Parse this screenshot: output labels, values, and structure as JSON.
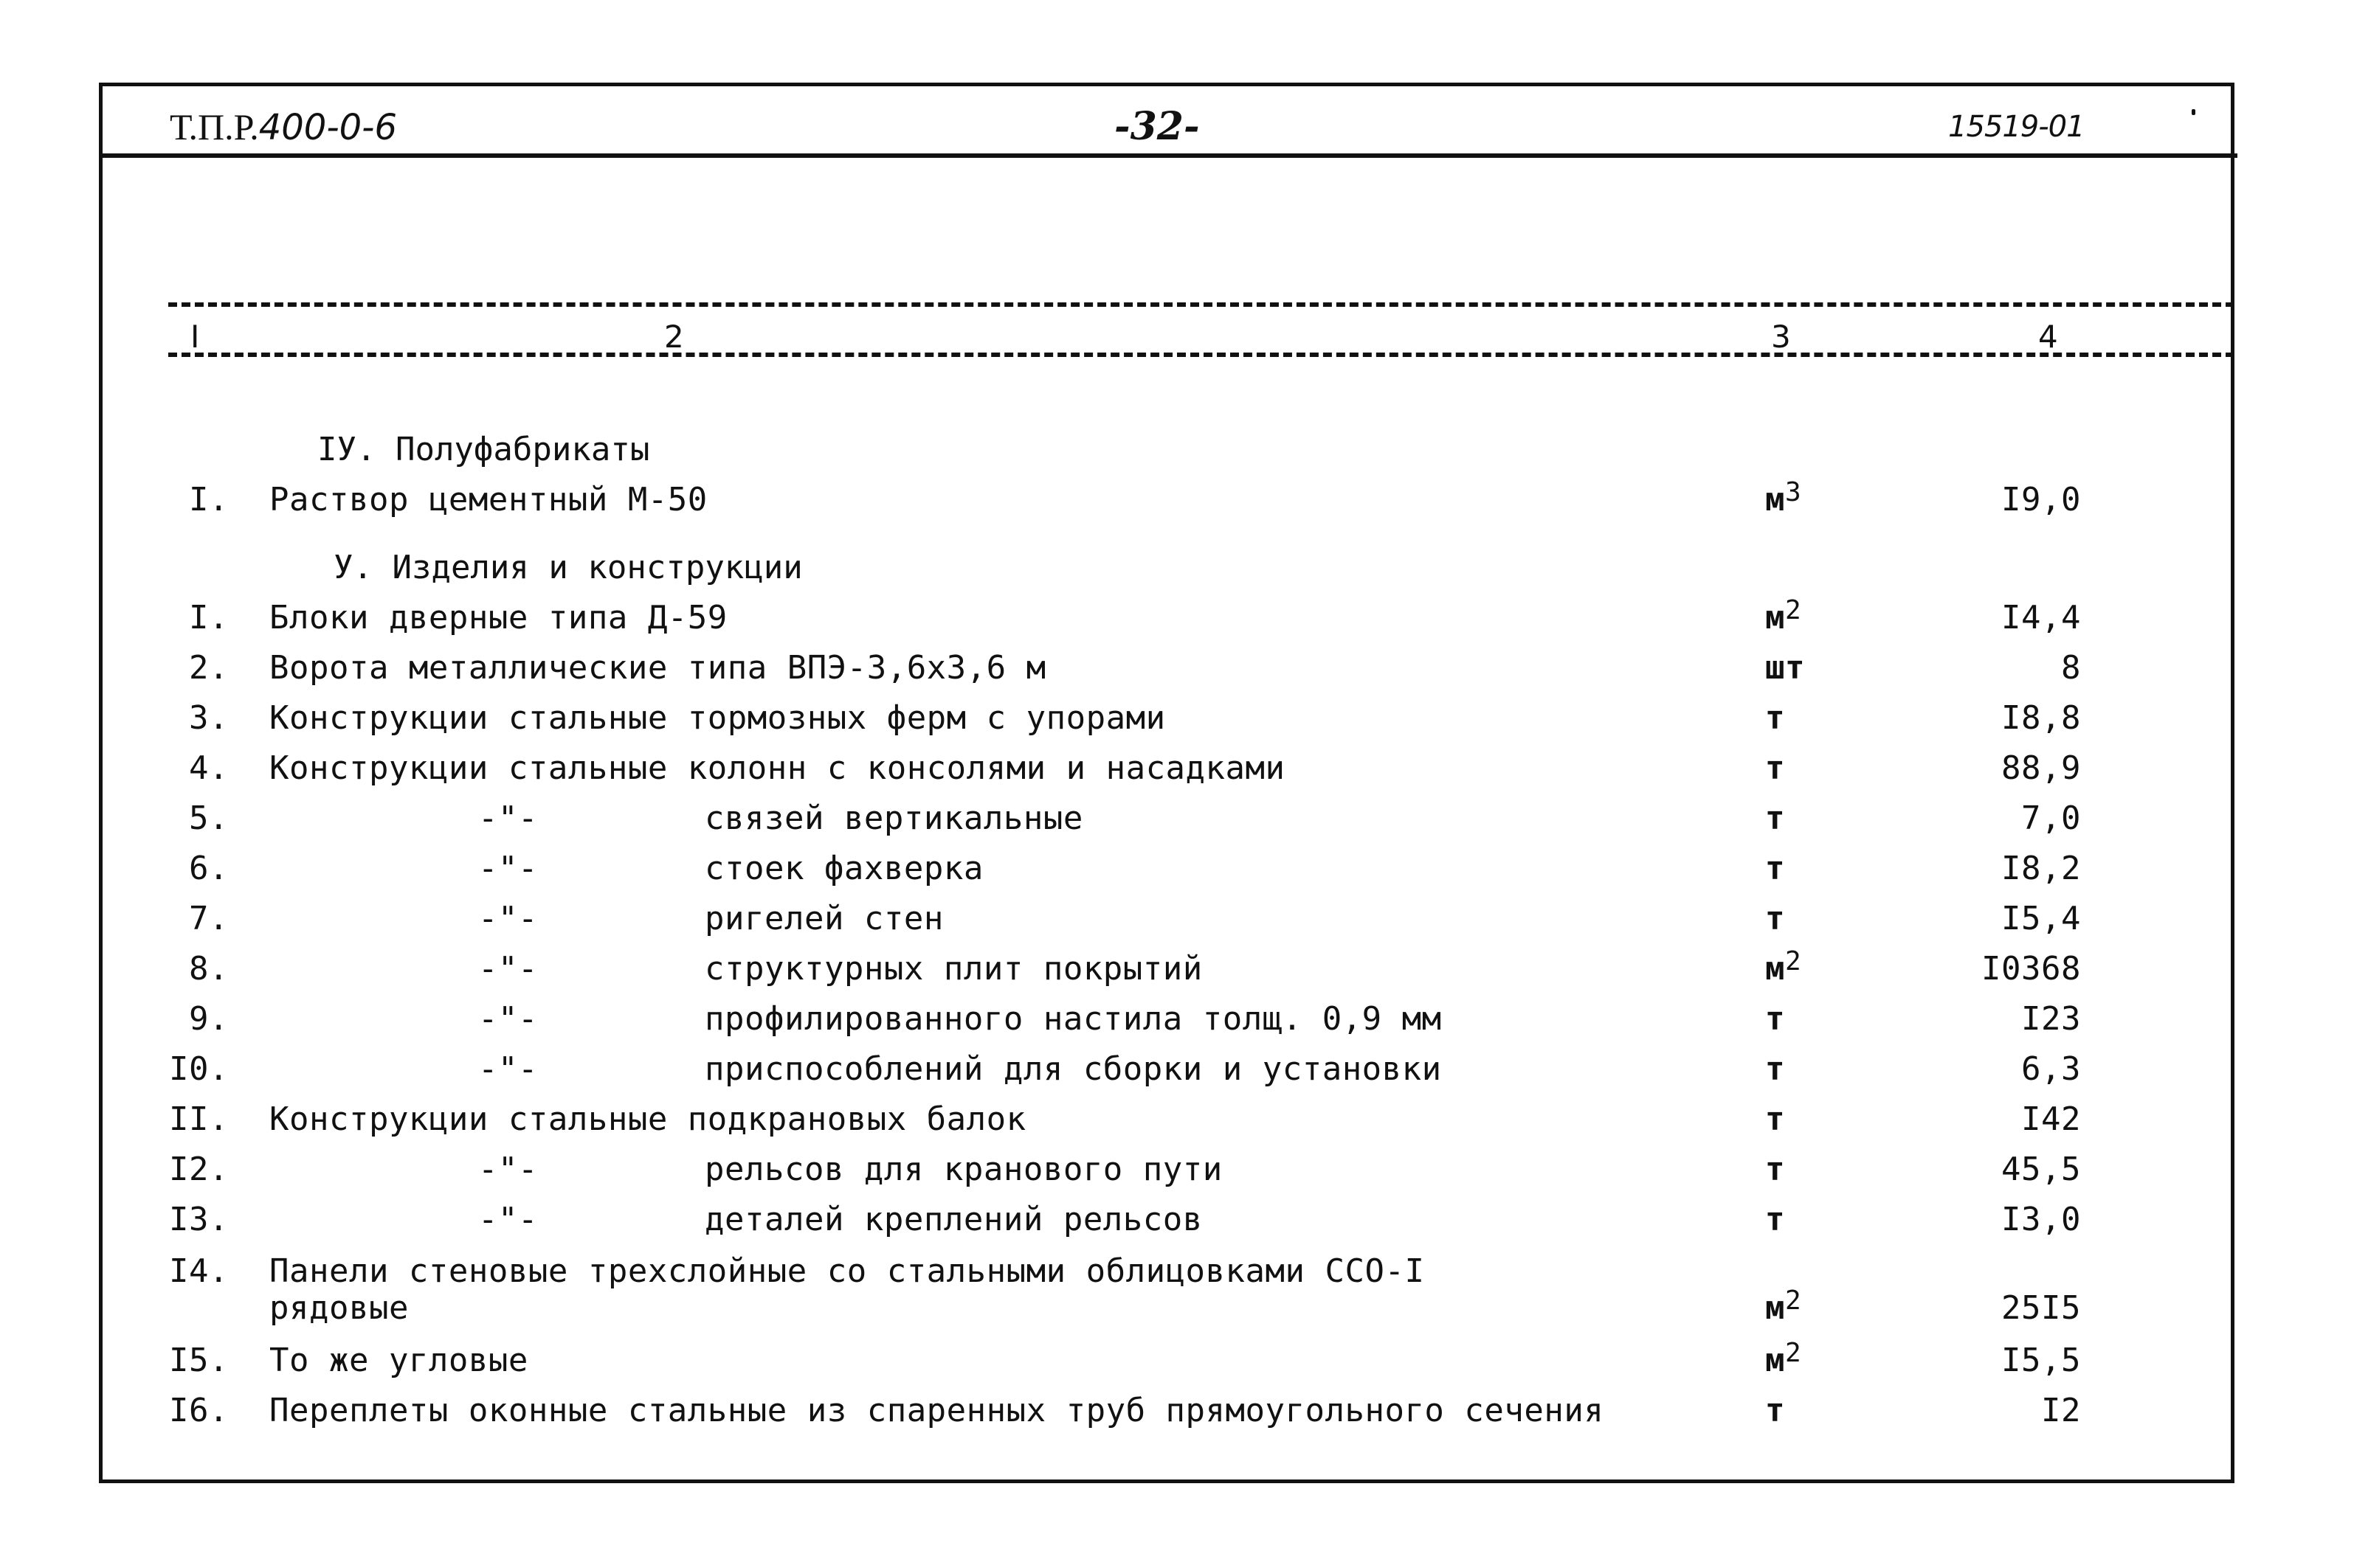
{
  "header": {
    "doc_code_prefix": "Т.П.Р.",
    "doc_code_number": "400-0-6",
    "page_number": "-32-",
    "sheet_code": "15519-01"
  },
  "columns": [
    "I",
    "2",
    "3",
    "4"
  ],
  "sections": [
    {
      "title": "IУ. Полуфабрикаты",
      "rows": [
        {
          "num": "I.",
          "text": "Раствор цементный М-50",
          "ditto": "",
          "text2": "",
          "unit": "м",
          "unit_sup": "3",
          "qty": "I9,0"
        }
      ]
    },
    {
      "title": "У. Изделия и конструкции",
      "rows": [
        {
          "num": "I.",
          "text": "Блоки дверные типа Д-59",
          "ditto": "",
          "text2": "",
          "unit": "м",
          "unit_sup": "2",
          "qty": "I4,4"
        },
        {
          "num": "2.",
          "text": "Ворота металлические типа ВПЭ-3,6х3,6 м",
          "ditto": "",
          "text2": "",
          "unit": "шт",
          "unit_sup": "",
          "qty": "8"
        },
        {
          "num": "3.",
          "text": "Конструкции стальные тормозных ферм с упорами",
          "ditto": "",
          "text2": "",
          "unit": "т",
          "unit_sup": "",
          "qty": "I8,8"
        },
        {
          "num": "4.",
          "text": "Конструкции стальные колонн с консолями и насадками",
          "ditto": "",
          "text2": "",
          "unit": "т",
          "unit_sup": "",
          "qty": "88,9"
        },
        {
          "num": "5.",
          "text": "",
          "ditto": "-\"-",
          "text2": "связей вертикальные",
          "unit": "т",
          "unit_sup": "",
          "qty": "7,0"
        },
        {
          "num": "6.",
          "text": "",
          "ditto": "-\"-",
          "text2": "стоек фахверка",
          "unit": "т",
          "unit_sup": "",
          "qty": "I8,2"
        },
        {
          "num": "7.",
          "text": "",
          "ditto": "-\"-",
          "text2": "ригелей стен",
          "unit": "т",
          "unit_sup": "",
          "qty": "I5,4"
        },
        {
          "num": "8.",
          "text": "",
          "ditto": "-\"-",
          "text2": "структурных плит покрытий",
          "unit": "м",
          "unit_sup": "2",
          "qty": "I0368"
        },
        {
          "num": "9.",
          "text": "",
          "ditto": "-\"-",
          "text2": "профилированного настила толщ. 0,9 мм",
          "unit": "т",
          "unit_sup": "",
          "qty": "I23"
        },
        {
          "num": "I0.",
          "text": "",
          "ditto": "-\"-",
          "text2": "приспособлений для сборки и установки",
          "unit": "т",
          "unit_sup": "",
          "qty": "6,3"
        },
        {
          "num": "II.",
          "text": "Конструкции стальные подкрановых балок",
          "ditto": "",
          "text2": "",
          "unit": "т",
          "unit_sup": "",
          "qty": "I42"
        },
        {
          "num": "I2.",
          "text": "",
          "ditto": "-\"-",
          "text2": "рельсов для кранового пути",
          "unit": "т",
          "unit_sup": "",
          "qty": "45,5"
        },
        {
          "num": "I3.",
          "text": "",
          "ditto": "-\"-",
          "text2": "деталей креплений рельсов",
          "unit": "т",
          "unit_sup": "",
          "qty": "I3,0"
        },
        {
          "num": "I4.",
          "text": "Панели стеновые трехслойные со стальными облицовками ССО-I",
          "text_line2": "рядовые",
          "ditto": "",
          "text2": "",
          "unit": "м",
          "unit_sup": "2",
          "qty": "25I5"
        },
        {
          "num": "I5.",
          "text": "То же угловые",
          "ditto": "",
          "text2": "",
          "unit": "м",
          "unit_sup": "2",
          "qty": "I5,5"
        },
        {
          "num": "I6.",
          "text": "Переплеты оконные стальные из спаренных труб прямоугольного сечения",
          "ditto": "",
          "text2": "",
          "unit": "т",
          "unit_sup": "",
          "qty": "I2"
        }
      ]
    }
  ]
}
